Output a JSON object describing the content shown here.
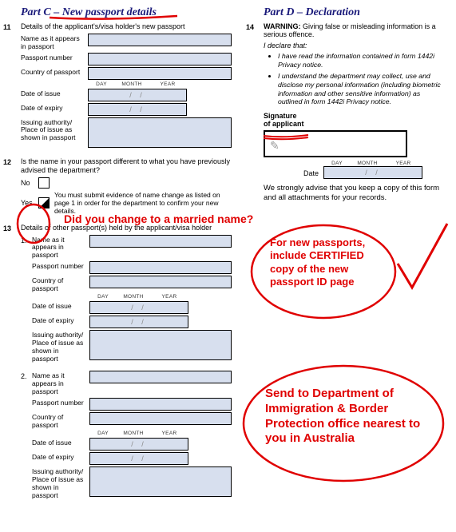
{
  "partC": {
    "title": "Part C – New passport details",
    "q11": {
      "num": "11",
      "text": "Details of the applicant's/visa holder's new passport",
      "nameLabel": "Name as it appears in passport",
      "passportNumLabel": "Passport number",
      "countryLabel": "Country of passport",
      "issueLabel": "Date of issue",
      "expiryLabel": "Date of expiry",
      "authorityLabel": "Issuing authority/ Place of issue as shown in passport",
      "dayHdr": "DAY",
      "monthHdr": "MONTH",
      "yearHdr": "YEAR",
      "dateSep": "/      /"
    },
    "q12": {
      "num": "12",
      "text": "Is the name in your passport different to what you have previously advised the department?",
      "noLabel": "No",
      "yesLabel": "Yes",
      "yesNote": "You must submit evidence of name change as listed on page 1 in order for the department to confirm your new details."
    },
    "q13": {
      "num": "13",
      "text": "Details of other passport(s) held by the applicant/visa holder",
      "item1Num": "1.",
      "item2Num": "2."
    }
  },
  "partD": {
    "title": "Part D – Declaration",
    "q14": {
      "num": "14",
      "warningLabel": "WARNING:",
      "warningText": "Giving false or misleading information is a serious offence.",
      "declare": "I declare that:",
      "bullet1": "I have read the information contained in form 1442i Privacy notice.",
      "bullet2": "I understand the department may collect, use and disclose my personal information (including biometric information and other sensitive information) as outlined in form 1442i Privacy notice.",
      "sigLabel1": "Signature",
      "sigLabel2": "of applicant",
      "dateLabel": "Date",
      "dayHdr": "DAY",
      "monthHdr": "MONTH",
      "yearHdr": "YEAR",
      "dateSep": "/      /",
      "advise": "We strongly advise that you keep a copy of this form and all attachments for your records."
    }
  },
  "annotations": {
    "married": "Did you change to a married name?",
    "certified": "For new passports, include CERTIFIED copy of the new passport ID page",
    "sendto": "Send to Department of Immigration & Border Protection office nearest to you in Australia"
  }
}
